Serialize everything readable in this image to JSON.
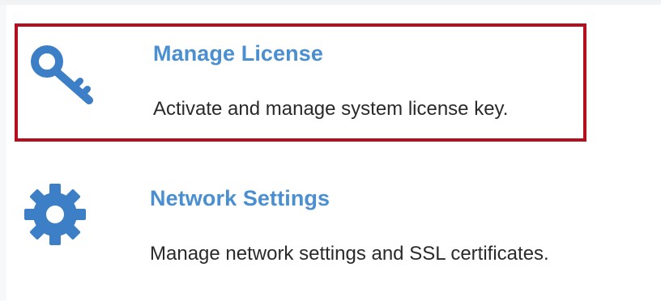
{
  "colors": {
    "accent": "#4a8fd1",
    "highlight_border": "#b50e1f",
    "description_text": "#2a2a2a",
    "icon": "#3d7fc6"
  },
  "settings": {
    "items": [
      {
        "icon": "key-icon",
        "title": "Manage License",
        "description": "Activate and manage system license key.",
        "highlighted": true
      },
      {
        "icon": "gear-icon",
        "title": "Network Settings",
        "description": "Manage network settings and SSL certificates.",
        "highlighted": false
      }
    ]
  }
}
